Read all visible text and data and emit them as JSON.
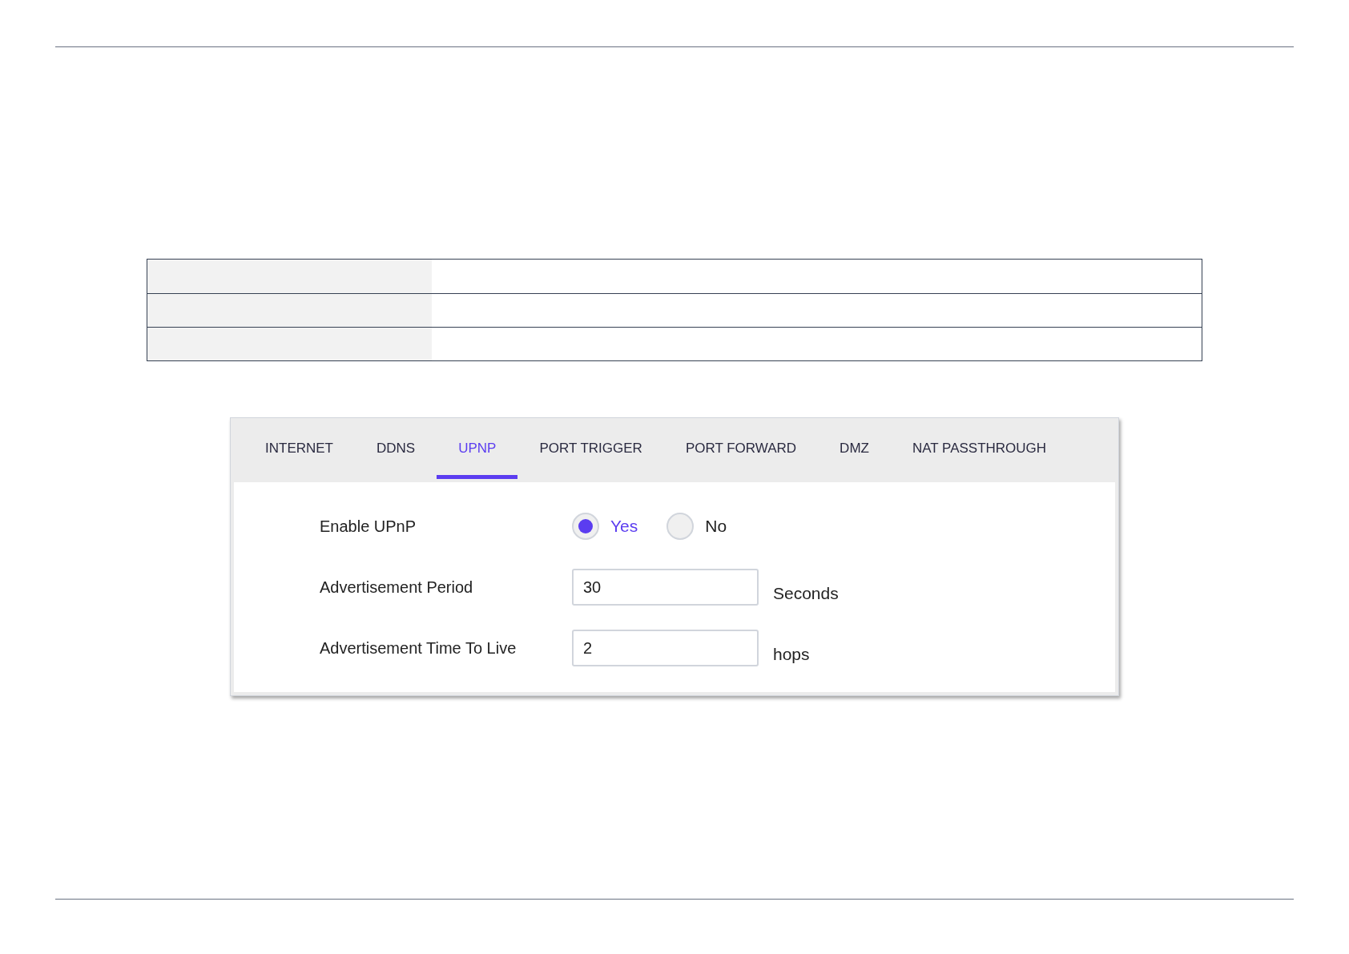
{
  "tabs": [
    {
      "label": "INTERNET",
      "selected": false
    },
    {
      "label": "DDNS",
      "selected": false
    },
    {
      "label": "UPNP",
      "selected": true
    },
    {
      "label": "PORT TRIGGER",
      "selected": false
    },
    {
      "label": "PORT FORWARD",
      "selected": false
    },
    {
      "label": "DMZ",
      "selected": false
    },
    {
      "label": "NAT PASSTHROUGH",
      "selected": false
    }
  ],
  "fields": [
    {
      "kind": "radio",
      "label": "Enable UPnP",
      "options": [
        {
          "label": "Yes",
          "selected": true
        },
        {
          "label": "No",
          "selected": false
        }
      ]
    },
    {
      "kind": "input",
      "label": "Advertisement Period",
      "value": "30",
      "unit": "Seconds"
    },
    {
      "kind": "input",
      "label": "Advertisement Time To Live",
      "value": "2",
      "unit": "hops"
    }
  ]
}
